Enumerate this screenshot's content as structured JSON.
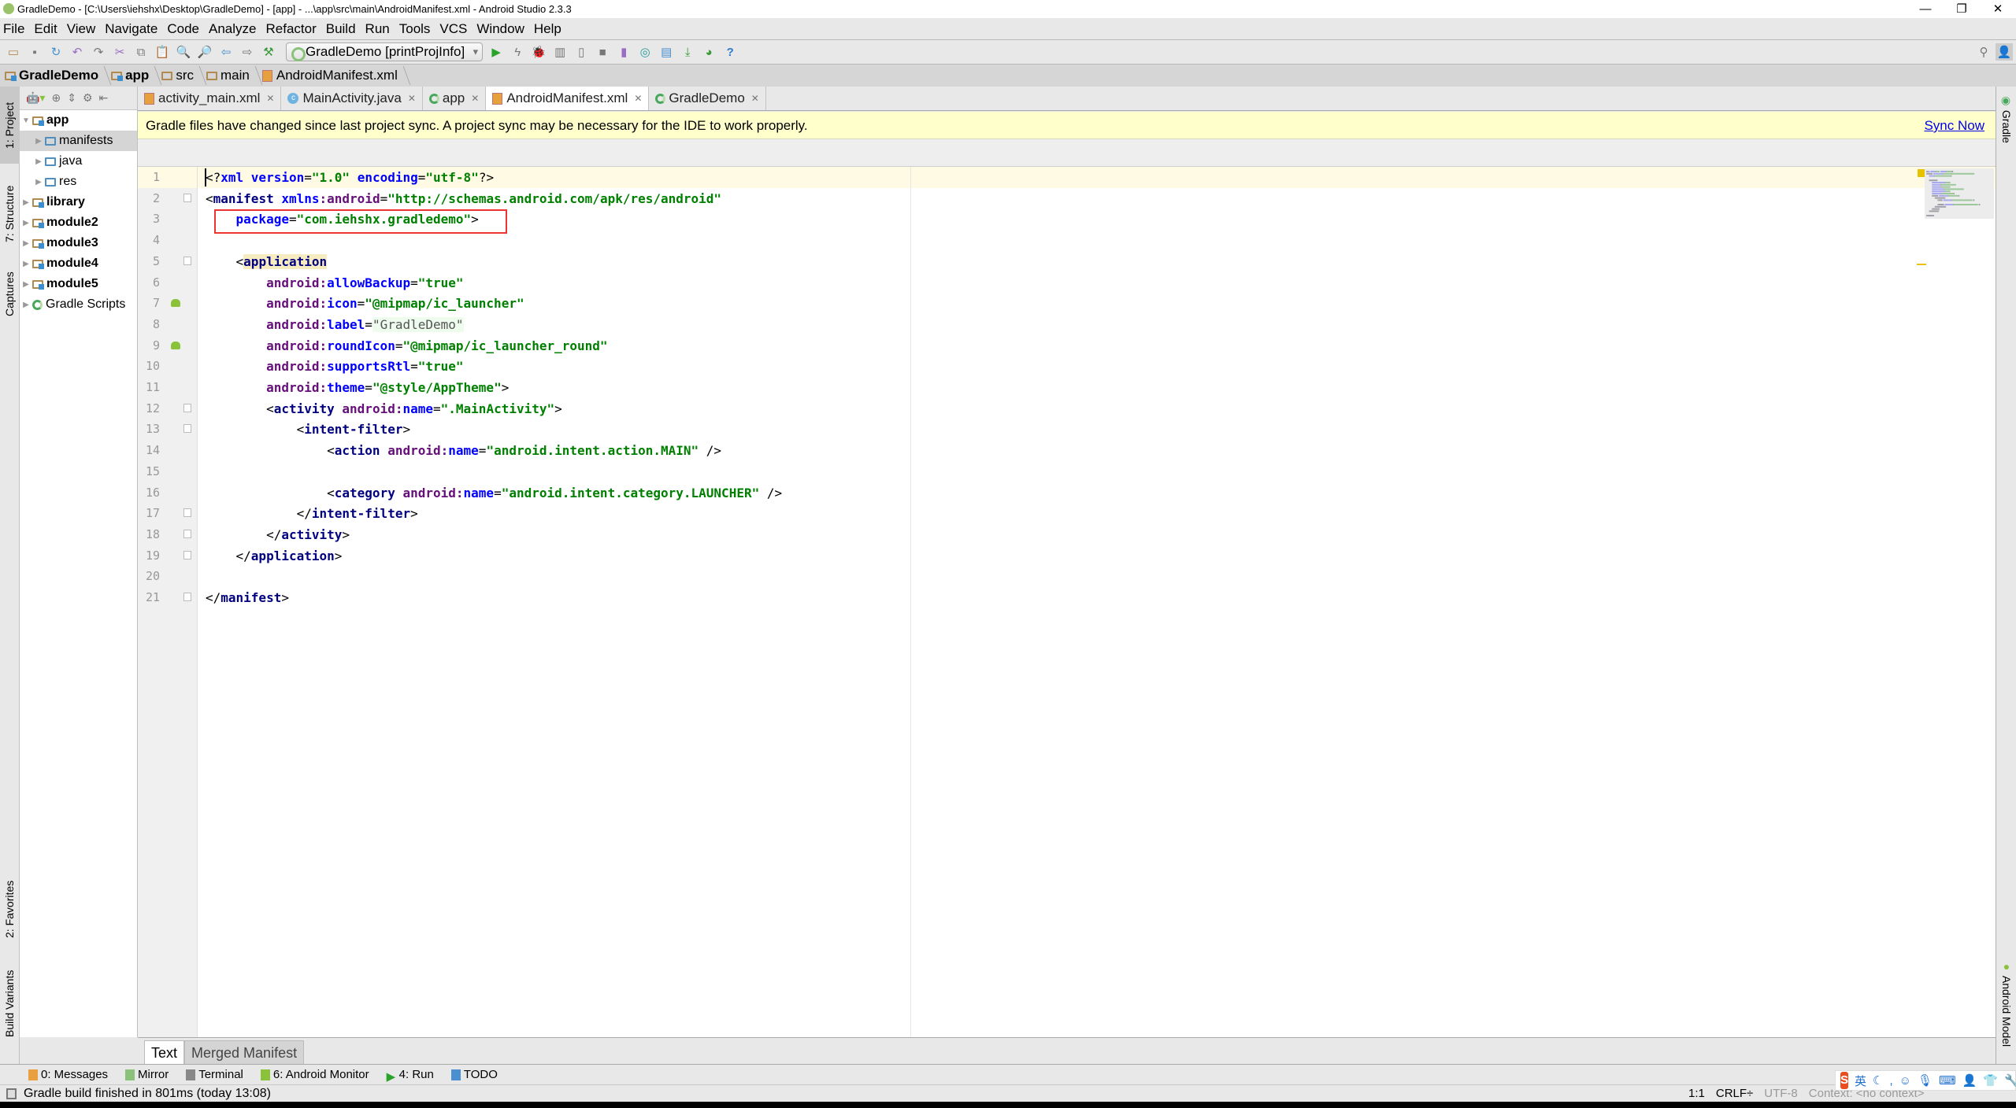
{
  "window": {
    "title": "GradleDemo - [C:\\Users\\iehshx\\Desktop\\GradleDemo] - [app] - ...\\app\\src\\main\\AndroidManifest.xml - Android Studio 2.3.3"
  },
  "menu": [
    "File",
    "Edit",
    "View",
    "Navigate",
    "Code",
    "Analyze",
    "Refactor",
    "Build",
    "Run",
    "Tools",
    "VCS",
    "Window",
    "Help"
  ],
  "toolbar": {
    "run_config": "GradleDemo [printProjInfo]"
  },
  "breadcrumb": [
    "GradleDemo",
    "app",
    "src",
    "main",
    "AndroidManifest.xml"
  ],
  "left_strip": [
    "1: Project",
    "7: Structure",
    "Captures",
    "2: Favorites",
    "Build Variants"
  ],
  "right_strip": [
    "Gradle",
    "Android Model"
  ],
  "project_tree": [
    {
      "label": "app",
      "bold": true,
      "level": 0,
      "expanded": true
    },
    {
      "label": "manifests",
      "level": 1,
      "selected": true
    },
    {
      "label": "java",
      "level": 1
    },
    {
      "label": "res",
      "level": 1
    },
    {
      "label": "library",
      "bold": true,
      "level": 0
    },
    {
      "label": "module2",
      "bold": true,
      "level": 0
    },
    {
      "label": "module3",
      "bold": true,
      "level": 0
    },
    {
      "label": "module4",
      "bold": true,
      "level": 0
    },
    {
      "label": "module5",
      "bold": true,
      "level": 0
    },
    {
      "label": "Gradle Scripts",
      "level": 0
    }
  ],
  "editor_tabs": [
    {
      "label": "activity_main.xml",
      "icon": "xml"
    },
    {
      "label": "MainActivity.java",
      "icon": "class"
    },
    {
      "label": "app",
      "icon": "gradle"
    },
    {
      "label": "AndroidManifest.xml",
      "icon": "xml",
      "active": true
    },
    {
      "label": "GradleDemo",
      "icon": "gradle"
    }
  ],
  "notification": {
    "text": "Gradle files have changed since last project sync. A project sync may be necessary for the IDE to work properly.",
    "action": "Sync Now"
  },
  "code_lines": [
    [
      [
        "p",
        "<?"
      ],
      [
        "attr",
        "xml "
      ],
      [
        "attr",
        "version"
      ],
      [
        "p",
        "="
      ],
      [
        "val",
        "\"1.0\""
      ],
      [
        "p",
        " "
      ],
      [
        "attr",
        "encoding"
      ],
      [
        "p",
        "="
      ],
      [
        "val",
        "\"utf-8\""
      ],
      [
        "p",
        "?>"
      ]
    ],
    [
      [
        "p",
        "<"
      ],
      [
        "tag",
        "manifest "
      ],
      [
        "attr",
        "xmlns"
      ],
      [
        "ns",
        ":android"
      ],
      [
        "p",
        "="
      ],
      [
        "val",
        "\"http://schemas.android.com/apk/res/android\""
      ]
    ],
    [
      [
        "p",
        "    "
      ],
      [
        "attr",
        "package"
      ],
      [
        "p",
        "="
      ],
      [
        "val",
        "\"com.iehshx.gradledemo\""
      ],
      [
        "p",
        ">"
      ]
    ],
    [],
    [
      [
        "p",
        "    <"
      ],
      [
        "hl",
        "application"
      ]
    ],
    [
      [
        "p",
        "        "
      ],
      [
        "ns",
        "android:"
      ],
      [
        "attr",
        "allowBackup"
      ],
      [
        "p",
        "="
      ],
      [
        "val",
        "\"true\""
      ]
    ],
    [
      [
        "p",
        "        "
      ],
      [
        "ns",
        "android:"
      ],
      [
        "attr",
        "icon"
      ],
      [
        "p",
        "="
      ],
      [
        "val",
        "\"@mipmap/ic_launcher\""
      ]
    ],
    [
      [
        "p",
        "        "
      ],
      [
        "ns",
        "android:"
      ],
      [
        "attr",
        "label"
      ],
      [
        "p",
        "="
      ],
      [
        "lbl",
        "\"GradleDemo\""
      ]
    ],
    [
      [
        "p",
        "        "
      ],
      [
        "ns",
        "android:"
      ],
      [
        "attr",
        "roundIcon"
      ],
      [
        "p",
        "="
      ],
      [
        "val",
        "\"@mipmap/ic_launcher_round\""
      ]
    ],
    [
      [
        "p",
        "        "
      ],
      [
        "ns",
        "android:"
      ],
      [
        "attr",
        "supportsRtl"
      ],
      [
        "p",
        "="
      ],
      [
        "val",
        "\"true\""
      ]
    ],
    [
      [
        "p",
        "        "
      ],
      [
        "ns",
        "android:"
      ],
      [
        "attr",
        "theme"
      ],
      [
        "p",
        "="
      ],
      [
        "val",
        "\"@style/AppTheme\""
      ],
      [
        "p",
        ">"
      ]
    ],
    [
      [
        "p",
        "        <"
      ],
      [
        "tag",
        "activity "
      ],
      [
        "ns",
        "android:"
      ],
      [
        "attr",
        "name"
      ],
      [
        "p",
        "="
      ],
      [
        "val",
        "\".MainActivity\""
      ],
      [
        "p",
        ">"
      ]
    ],
    [
      [
        "p",
        "            <"
      ],
      [
        "tag",
        "intent-filter"
      ],
      [
        "p",
        ">"
      ]
    ],
    [
      [
        "p",
        "                <"
      ],
      [
        "tag",
        "action "
      ],
      [
        "ns",
        "android:"
      ],
      [
        "attr",
        "name"
      ],
      [
        "p",
        "="
      ],
      [
        "val",
        "\"android.intent.action.MAIN\""
      ],
      [
        "p",
        " />"
      ]
    ],
    [],
    [
      [
        "p",
        "                <"
      ],
      [
        "tag",
        "category "
      ],
      [
        "ns",
        "android:"
      ],
      [
        "attr",
        "name"
      ],
      [
        "p",
        "="
      ],
      [
        "val",
        "\"android.intent.category.LAUNCHER\""
      ],
      [
        "p",
        " />"
      ]
    ],
    [
      [
        "p",
        "            </"
      ],
      [
        "tag",
        "intent-filter"
      ],
      [
        "p",
        ">"
      ]
    ],
    [
      [
        "p",
        "        </"
      ],
      [
        "tag",
        "activity"
      ],
      [
        "p",
        ">"
      ]
    ],
    [
      [
        "p",
        "    </"
      ],
      [
        "tag",
        "application"
      ],
      [
        "p",
        ">"
      ]
    ],
    [],
    [
      [
        "p",
        "</"
      ],
      [
        "tag",
        "manifest"
      ],
      [
        "p",
        ">"
      ]
    ]
  ],
  "bottom_tabs": {
    "text": "Text",
    "merged": "Merged Manifest"
  },
  "tool_windows": [
    "0: Messages",
    "Mirror",
    "Terminal",
    "6: Android Monitor",
    "4: Run",
    "TODO"
  ],
  "status": {
    "message": "Gradle build finished in 801ms (today 13:08)",
    "position": "1:1",
    "line_sep": "CRLF÷",
    "encoding": "UTF-8",
    "context": "Context: <no context>"
  },
  "ime": {
    "mode": "英"
  }
}
